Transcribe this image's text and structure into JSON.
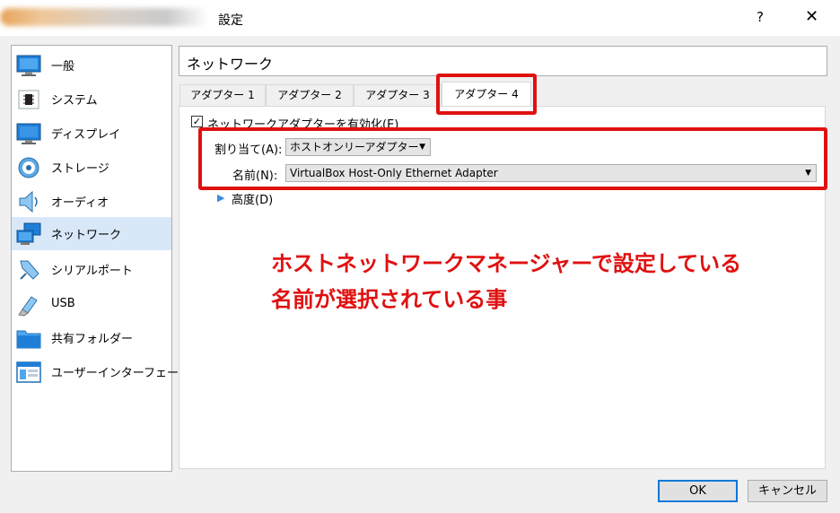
{
  "window": {
    "title": "設定",
    "help": "?",
    "close": "✕"
  },
  "sidebar": {
    "items": [
      {
        "label": "一般",
        "icon": "monitor-icon"
      },
      {
        "label": "システム",
        "icon": "chip-icon"
      },
      {
        "label": "ディスプレイ",
        "icon": "display-icon"
      },
      {
        "label": "ストレージ",
        "icon": "disk-icon"
      },
      {
        "label": "オーディオ",
        "icon": "speaker-icon"
      },
      {
        "label": "ネットワーク",
        "icon": "network-icon"
      },
      {
        "label": "シリアルポート",
        "icon": "serial-port-icon"
      },
      {
        "label": "USB",
        "icon": "usb-icon"
      },
      {
        "label": "共有フォルダー",
        "icon": "folder-icon"
      },
      {
        "label": "ユーザーインターフェース",
        "icon": "ui-icon"
      }
    ],
    "selected": "ネットワーク"
  },
  "page": {
    "title": "ネットワーク"
  },
  "tabs": [
    {
      "label": "アダプター 1"
    },
    {
      "label": "アダプター 2"
    },
    {
      "label": "アダプター 3"
    },
    {
      "label": "アダプター 4"
    }
  ],
  "adapter": {
    "enable_label": "ネットワークアダプターを有効化(E)",
    "enable_checked": "✓",
    "attached_label": "割り当て(A):",
    "attached_value": "ホストオンリーアダプター",
    "name_label": "名前(N):",
    "name_value": "VirtualBox Host-Only Ethernet Adapter",
    "advanced_label": "高度(D)"
  },
  "annotation": {
    "line1": "ホストネットワークマネージャーで設定している",
    "line2": "名前が選択されている事",
    "color": "#e01010"
  },
  "buttons": {
    "ok": "OK",
    "cancel": "キャンセル"
  }
}
